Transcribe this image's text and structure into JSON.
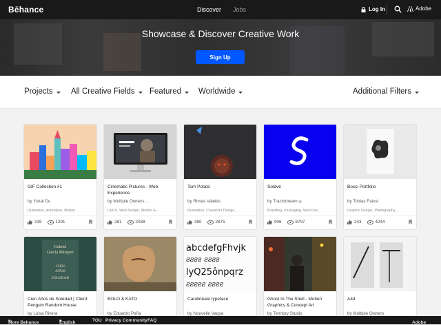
{
  "header": {
    "logo": "Bēhance",
    "nav": [
      "Discover",
      "Jobs"
    ],
    "login": "Log In",
    "adobe": "Adobe"
  },
  "hero": {
    "title": "Showcase & Discover Creative Work",
    "signup": "Sign Up"
  },
  "filters": {
    "items": [
      "Projects",
      "All Creative Fields",
      "Featured",
      "Worldwide"
    ],
    "additional": "Additional Filters"
  },
  "projects": [
    {
      "title": "GIF Collection #1",
      "owner": "Yukai Du",
      "fields": "Illustration, Animation, Motion...",
      "likes": "319",
      "views": "1291",
      "thumb": "city"
    },
    {
      "title": "Cinematic Pictures - Web Experience",
      "owner": "Multiple Owners",
      "fields": "UI/UX, Web Design, Motion G...",
      "likes": "281",
      "views": "2038",
      "thumb": "monitor"
    },
    {
      "title": "Tom Potato",
      "owner": "Rimas Valekis",
      "fields": "Illustration, Character Design, ...",
      "likes": "390",
      "views": "2875",
      "thumb": "potato"
    },
    {
      "title": "Solavé",
      "owner": "Tractorbeam",
      "fields": "Branding, Packaging, Web Des...",
      "likes": "906",
      "views": "8797",
      "thumb": "solave"
    },
    {
      "title": "Bocci Portfolio",
      "owner": "Tobias Faisst",
      "fields": "Graphic Design, Photography,...",
      "likes": "243",
      "views": "4244",
      "thumb": "bocci"
    },
    {
      "title": "Cien Años de Soledad | Client: Penguin Random House",
      "owner": "Luisa Rivera",
      "fields": "",
      "likes": "",
      "views": "",
      "thumb": "book"
    },
    {
      "title": "BOLO & KATO",
      "owner": "Eduardo Peña",
      "fields": "",
      "likes": "",
      "views": "",
      "thumb": "bolo"
    },
    {
      "title": "Carolinéale typeface",
      "owner": "Nouvelle Vague",
      "fields": "",
      "likes": "",
      "views": "",
      "thumb": "type"
    },
    {
      "title": "Ghost In The Shell - Motion Graphics & Concept Art",
      "owner": "Territory Studio",
      "fields": "",
      "likes": "",
      "views": "",
      "thumb": "ghost"
    },
    {
      "title": "A44",
      "owner": "Multiple Owners",
      "fields": "",
      "likes": "",
      "views": "",
      "thumb": "a44"
    }
  ],
  "book_text": {
    "line1": "Gabriel",
    "line2": "García Márquez",
    "line3": "CIEN",
    "line4": "AÑOS",
    "line5": "SOLEDAD"
  },
  "type_sample": {
    "line1": "abcdefgFhvjk",
    "line2": "ƨƨƨƨ ƨƨƨƨ",
    "line3": "lyQ25ônpqrz",
    "line4": "ƨƨƨƨƨ ƨƨƨƨ"
  },
  "footer": {
    "more": "More Behance",
    "language": "English",
    "links": [
      "TOU",
      "Privacy",
      "Community",
      "FAQ"
    ],
    "adobe": "Adobe"
  }
}
